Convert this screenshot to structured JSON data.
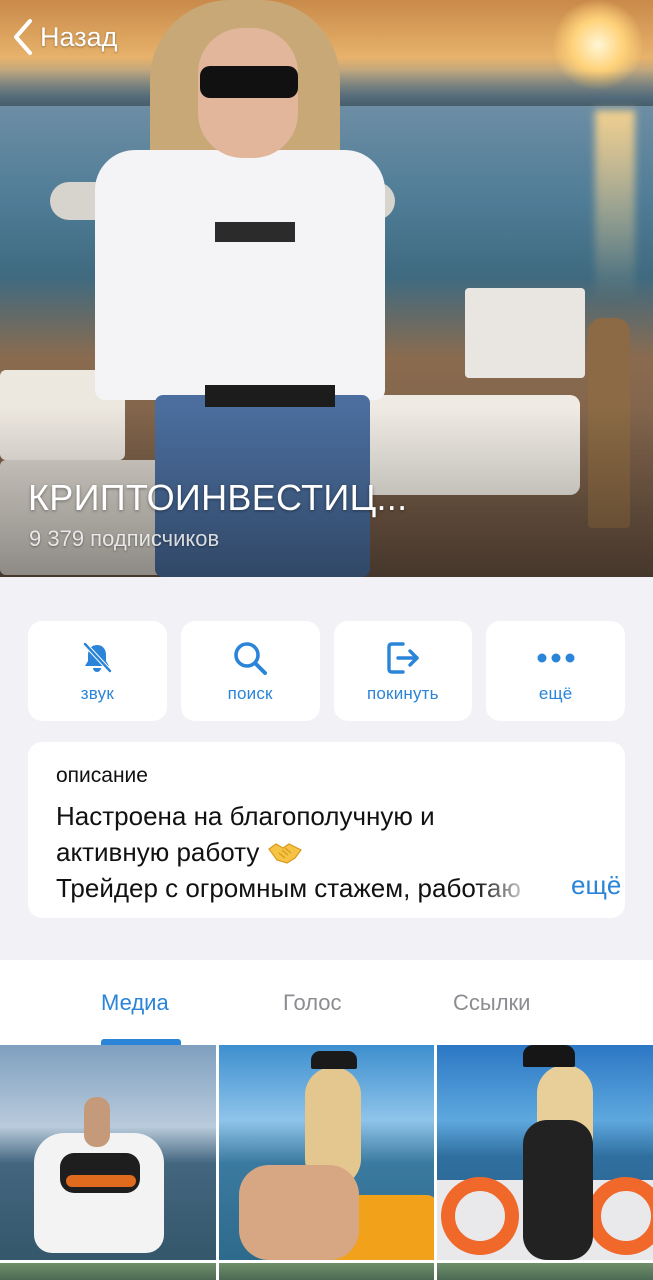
{
  "nav": {
    "back_label": "Назад"
  },
  "channel": {
    "title": "КРИПТОИНВЕСТИЦ...",
    "subscribers": "9 379 подписчиков"
  },
  "actions": [
    {
      "label": "звук",
      "icon": "bell-slash-icon"
    },
    {
      "label": "поиск",
      "icon": "search-icon"
    },
    {
      "label": "покинуть",
      "icon": "leave-icon"
    },
    {
      "label": "ещё",
      "icon": "more-icon"
    }
  ],
  "description": {
    "heading": "описание",
    "line1": "Настроена на благополучную и",
    "line2": "активную работу",
    "line3": "Трейдер с огромным стажем, работаю",
    "more_label": "ещё",
    "emoji": "handshake-icon"
  },
  "tabs": {
    "items": [
      "Медиа",
      "Голос",
      "Ссылки"
    ],
    "active": "Медиа"
  },
  "colors": {
    "accent": "#2a84d8",
    "background": "#f1f1f6",
    "card": "#ffffff",
    "muted_tab": "#8c8c92"
  }
}
